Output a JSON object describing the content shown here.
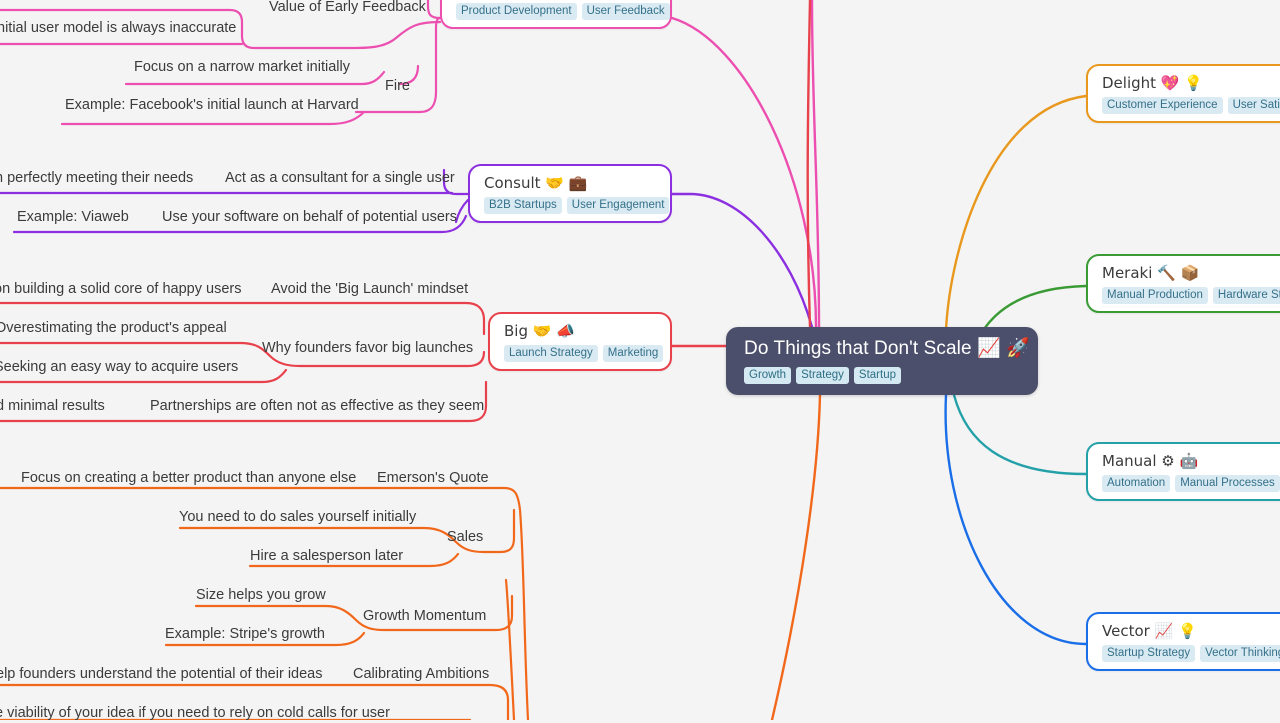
{
  "canvas": {
    "background": "#f4f4f4",
    "root": {
      "title": "Do Things that Don't Scale 📈 🚀",
      "tags": [
        "Growth",
        "Strategy",
        "Startup"
      ],
      "color": "#4b4f6b",
      "text_color": "#ffffff"
    }
  },
  "branches": [
    {
      "id": "talk",
      "title_tags": [
        "Product Development",
        "User Feedback"
      ],
      "color": "#ec4fb0",
      "side": "top",
      "leaves": [
        "Value of Early Feedback",
        "nitial user model is always inaccurate",
        "Fire",
        "Focus on a narrow market initially",
        "Example: Facebook's initial launch at Harvard"
      ]
    },
    {
      "id": "consult",
      "title": "Consult 🤝 💼",
      "tags": [
        "B2B Startups",
        "User Engagement"
      ],
      "color": "#8b2fe0",
      "side": "left",
      "leaves": [
        "Act as a consultant for a single user",
        "n perfectly meeting their needs",
        "Use your software on behalf of potential users",
        "Example: Viaweb"
      ]
    },
    {
      "id": "big",
      "title": "Big 🤝 📣",
      "tags": [
        "Launch Strategy",
        "Marketing"
      ],
      "color": "#e8414b",
      "side": "left",
      "leaves": [
        "Avoid the 'Big Launch' mindset",
        "on building a solid core of happy users",
        "Why founders favor big launches",
        "Overestimating the product's appeal",
        "Seeking an easy way to acquire users",
        "Partnerships are often not as effective as they seem",
        "d minimal results"
      ]
    },
    {
      "id": "sales",
      "title_hidden": "",
      "color": "#f2681b",
      "side": "bottom-left",
      "leaves": [
        "Emerson's Quote",
        "Focus on creating a better product than anyone else",
        "Sales",
        "You need to do sales yourself initially",
        "Hire a salesperson later",
        "Growth Momentum",
        "Size helps you grow",
        "Example: Stripe's growth",
        "Calibrating Ambitions",
        "elp founders understand the potential of their ideas",
        "e viability of your idea if you need to rely on cold calls for user"
      ]
    },
    {
      "id": "delight",
      "title": "Delight 💖 💡",
      "tags": [
        "Customer Experience",
        "User Satisfac"
      ],
      "color": "#e8981c",
      "side": "right"
    },
    {
      "id": "meraki",
      "title": "Meraki 🔨 📦",
      "tags": [
        "Manual Production",
        "Hardware Start"
      ],
      "color": "#3a9b35",
      "side": "right"
    },
    {
      "id": "manual",
      "title": "Manual ⚙ 🤖",
      "tags": [
        "Automation",
        "Manual Processes"
      ],
      "color": "#23a0a8",
      "side": "right"
    },
    {
      "id": "vector",
      "title": "Vector 📈 💡",
      "tags": [
        "Startup Strategy",
        "Vector Thinking"
      ],
      "color": "#1a6ee8",
      "side": "right"
    }
  ],
  "nodes": {
    "top_pink": {
      "tag1": "Product Development",
      "tag2": "User Feedback"
    },
    "consult": {
      "title": "Consult 🤝 💼",
      "tag1": "B2B Startups",
      "tag2": "User Engagement"
    },
    "big": {
      "title": "Big 🤝 📣",
      "tag1": "Launch Strategy",
      "tag2": "Marketing"
    },
    "delight": {
      "title": "Delight 💖 💡",
      "tag1": "Customer Experience",
      "tag2": "User Satisfac"
    },
    "meraki": {
      "title": "Meraki 🔨 📦",
      "tag1": "Manual Production",
      "tag2": "Hardware Start"
    },
    "manual": {
      "title": "Manual ⚙ 🤖",
      "tag1": "Automation",
      "tag2": "Manual Processes"
    },
    "vector": {
      "title": "Vector 📈 💡",
      "tag1": "Startup Strategy",
      "tag2": "Vector Thinking"
    }
  },
  "leaves": {
    "early_feedback": "Value of Early Feedback",
    "user_model": "nitial user model is always inaccurate",
    "fire": "Fire",
    "narrow_market": "Focus on a narrow market initially",
    "facebook": "Example: Facebook's initial launch at Harvard",
    "consultant_single": "Act as a consultant for a single user",
    "perfectly_meeting": "n perfectly meeting their needs",
    "use_software": "Use your software on behalf of potential users",
    "viaweb": "Example: Viaweb",
    "avoid_big_launch": "Avoid the 'Big Launch' mindset",
    "solid_core": "on building a solid core of happy users",
    "why_founders": "Why founders favor big launches",
    "overestimating": "Overestimating the product's appeal",
    "easy_way": "Seeking an easy way to acquire users",
    "partnerships": "Partnerships are often not as effective as they seem",
    "minimal_results": "d minimal results",
    "emersons_quote": "Emerson's Quote",
    "better_product": "Focus on creating a better product than anyone else",
    "sales": "Sales",
    "sales_yourself": "You need to do sales yourself initially",
    "hire_salesperson": "Hire a salesperson later",
    "growth_momentum": "Growth Momentum",
    "size_helps": "Size helps you grow",
    "stripe": "Example: Stripe's growth",
    "calibrating": "Calibrating Ambitions",
    "help_founders": "elp founders understand the potential of their ideas",
    "cold_calls": "e viability of your idea if you need to rely on cold calls for user"
  },
  "root_tags": {
    "t0": "Growth",
    "t1": "Strategy",
    "t2": "Startup"
  }
}
